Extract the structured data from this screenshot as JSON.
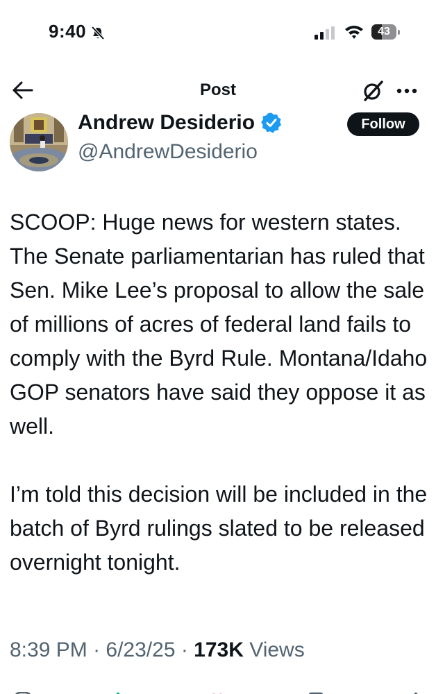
{
  "status_bar": {
    "time": "9:40",
    "battery_level": "43"
  },
  "nav": {
    "title": "Post"
  },
  "author": {
    "name": "Andrew Desiderio",
    "handle": "@AndrewDesiderio",
    "follow_label": "Follow"
  },
  "post": {
    "paragraphs": [
      "SCOOP: Huge news for western states. The Senate parliamentarian has ruled that Sen. Mike Lee’s proposal to allow the sale of millions of acres of federal land fails to comply with the Byrd Rule. Montana/Idaho GOP senators have said they oppose it as well.",
      "I’m told this decision will be included in the batch of Byrd rulings slated to be released overnight tonight."
    ],
    "time": "8:39 PM",
    "date": "6/23/25",
    "views_count": "173K",
    "views_label": "Views"
  },
  "colors": {
    "text": "#0f1419",
    "secondary": "#536471",
    "verified": "#1d9bf0",
    "follow_bg": "#0f1419"
  },
  "icons": [
    "bell-slash-icon",
    "signal-icon",
    "wifi-icon",
    "battery-icon",
    "back-arrow-icon",
    "grok-icon",
    "more-icon",
    "verified-icon"
  ]
}
